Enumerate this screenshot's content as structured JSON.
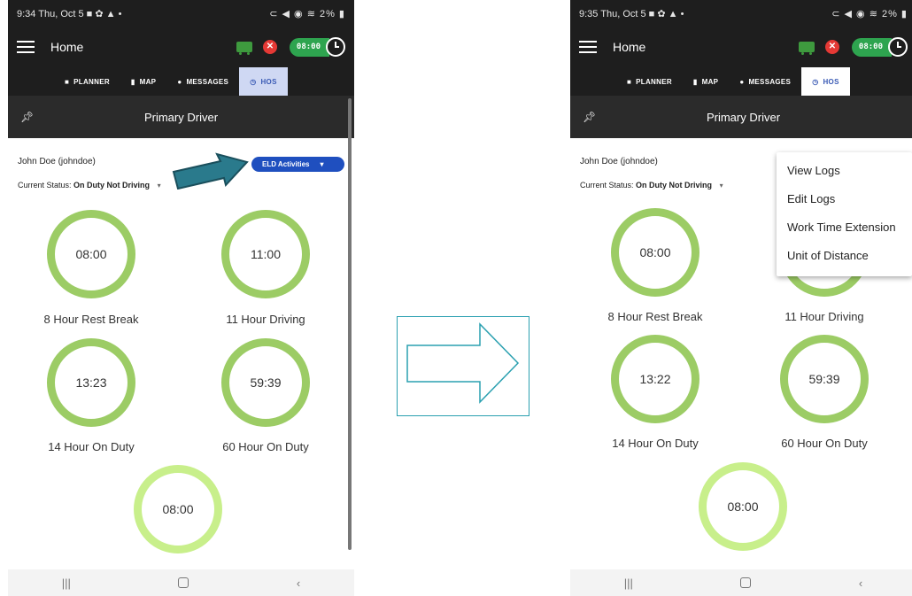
{
  "left": {
    "status_time": "9:34 Thu, Oct 5 ■ ✿ ▲ •",
    "status_right": "⊂ ◀ ◉ ≋ 2% ▮",
    "app_title": "Home",
    "clock_value": "08:00",
    "tabs": [
      "PLANNER",
      "MAP",
      "MESSAGES",
      "HOS"
    ],
    "driver_header": "Primary Driver",
    "driver_name": "John Doe (johndoe)",
    "current_status_label": "Current Status:",
    "current_status_value": "On Duty Not Driving",
    "eld_button": "ELD Activities",
    "timers": [
      {
        "value": "08:00",
        "label": "8 Hour Rest Break"
      },
      {
        "value": "11:00",
        "label": "11 Hour Driving"
      },
      {
        "value": "13:23",
        "label": "14 Hour On Duty"
      },
      {
        "value": "59:39",
        "label": "60 Hour On Duty"
      },
      {
        "value": "08:00",
        "label": ""
      }
    ]
  },
  "right": {
    "status_time": "9:35 Thu, Oct 5 ■ ✿ ▲ •",
    "status_right": "⊂ ◀ ◉ ≋ 2% ▮",
    "app_title": "Home",
    "clock_value": "08:00",
    "tabs": [
      "PLANNER",
      "MAP",
      "MESSAGES",
      "HOS"
    ],
    "driver_header": "Primary Driver",
    "driver_name": "John Doe (johndoe)",
    "current_status_label": "Current Status:",
    "current_status_value": "On Duty Not Driving",
    "menu_items": [
      "View Logs",
      "Edit Logs",
      "Work Time Extension",
      "Unit of Distance"
    ],
    "timers": [
      {
        "value": "08:00",
        "label": "8 Hour Rest Break"
      },
      {
        "value": "",
        "label": "11 Hour Driving"
      },
      {
        "value": "13:22",
        "label": "14 Hour On Duty"
      },
      {
        "value": "59:39",
        "label": "60 Hour On Duty"
      },
      {
        "value": "08:00",
        "label": ""
      }
    ]
  },
  "colors": {
    "ring_green": "#9ccc65",
    "ring_light": "#c8ef8b",
    "eld_blue": "#1f4fbf",
    "callout_arrow": "#2a7a8c",
    "transition_arrow": "#2aa0b0"
  }
}
